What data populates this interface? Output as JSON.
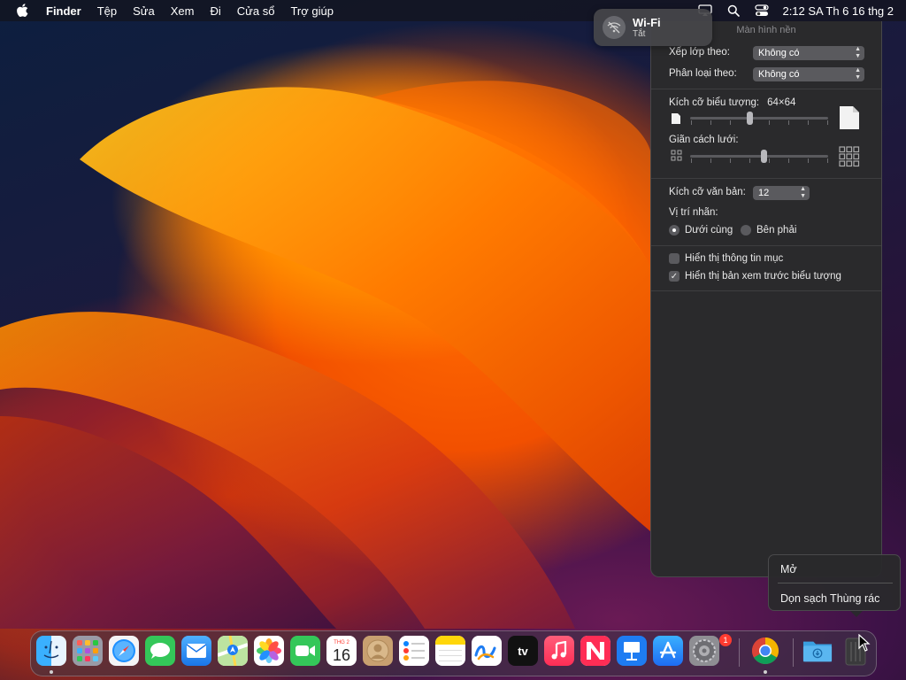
{
  "menubar": {
    "app_name": "Finder",
    "items": [
      "Tệp",
      "Sửa",
      "Xem",
      "Đi",
      "Cửa sổ",
      "Trợ giúp"
    ],
    "clock": "2:12 SA Th 6 16 thg 2"
  },
  "wifi": {
    "title": "Wi-Fi",
    "status": "Tắt"
  },
  "panel": {
    "title": "Màn hình nền",
    "stack_label": "Xếp lớp theo:",
    "stack_value": "Không có",
    "sort_label": "Phân loại theo:",
    "sort_value": "Không có",
    "icon_size_label": "Kích cỡ biểu tượng:",
    "icon_size_value": "64×64",
    "icon_size_level": 0.4,
    "grid_spacing_label": "Giãn cách lưới:",
    "grid_spacing_level": 0.55,
    "text_size_label": "Kích cỡ văn bản:",
    "text_size_value": "12",
    "label_position_label": "Vị trí nhãn:",
    "label_bottom": "Dưới cùng",
    "label_right": "Bên phải",
    "label_position_selected": "bottom",
    "show_item_info": "Hiển thị thông tin mục",
    "show_item_info_checked": false,
    "show_icon_preview": "Hiển thị bản xem trước biểu tượng",
    "show_icon_preview_checked": true
  },
  "context_menu": {
    "open": "Mở",
    "empty_trash": "Dọn sạch Thùng rác"
  },
  "dock": {
    "calendar_month": "THG 2",
    "calendar_day": "16",
    "tv_label": "tv",
    "settings_badge": "1",
    "apps": [
      "finder",
      "launchpad",
      "safari",
      "messages",
      "mail",
      "maps",
      "photos",
      "facetime",
      "calendar",
      "contacts",
      "reminders",
      "notes",
      "freeform",
      "tv",
      "music",
      "news",
      "keynote",
      "app-store",
      "system-settings",
      "chrome",
      "downloads",
      "trash"
    ]
  }
}
